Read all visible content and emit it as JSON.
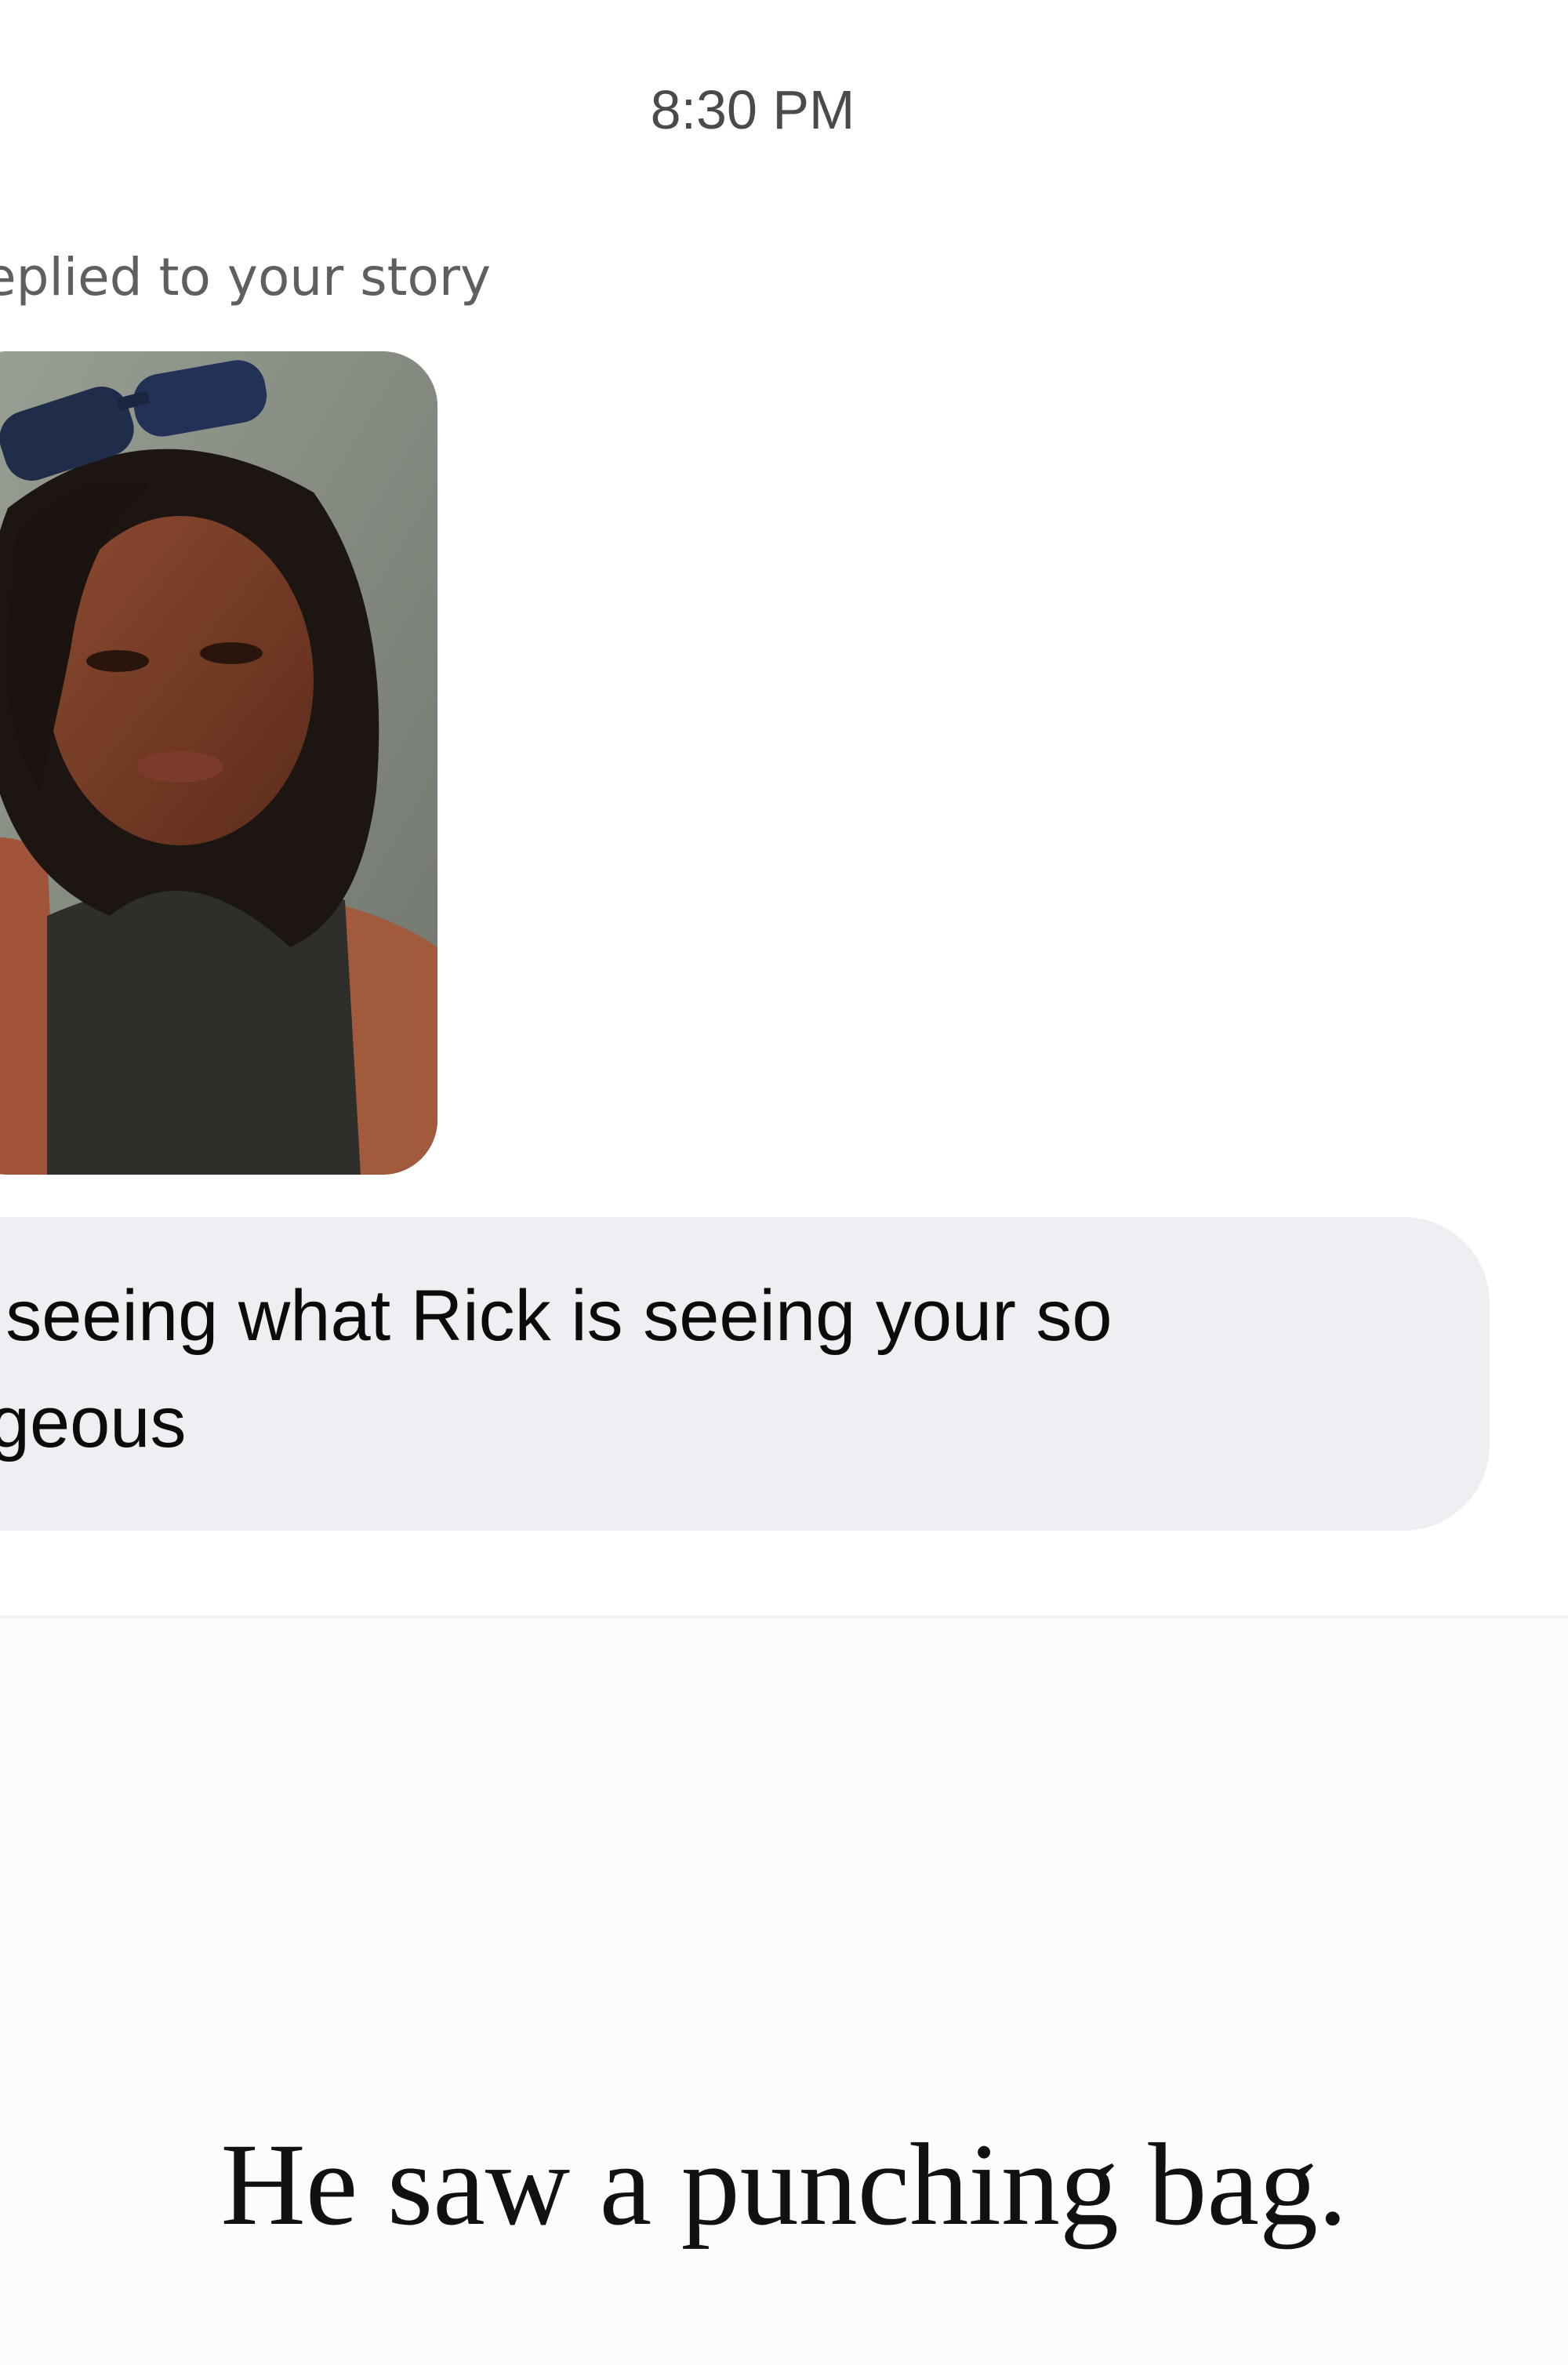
{
  "chat": {
    "timestamp": "8:30 PM",
    "story_reply_label": "eplied to your story",
    "message_text": "m seeing what Rick is seeing your so\norgeous"
  },
  "caption": "He saw a punching bag.",
  "colors": {
    "bubble": "#efeff3",
    "timestamp": "#4a4a4a",
    "label": "#5f5f5f",
    "text": "#0b0b0b"
  }
}
